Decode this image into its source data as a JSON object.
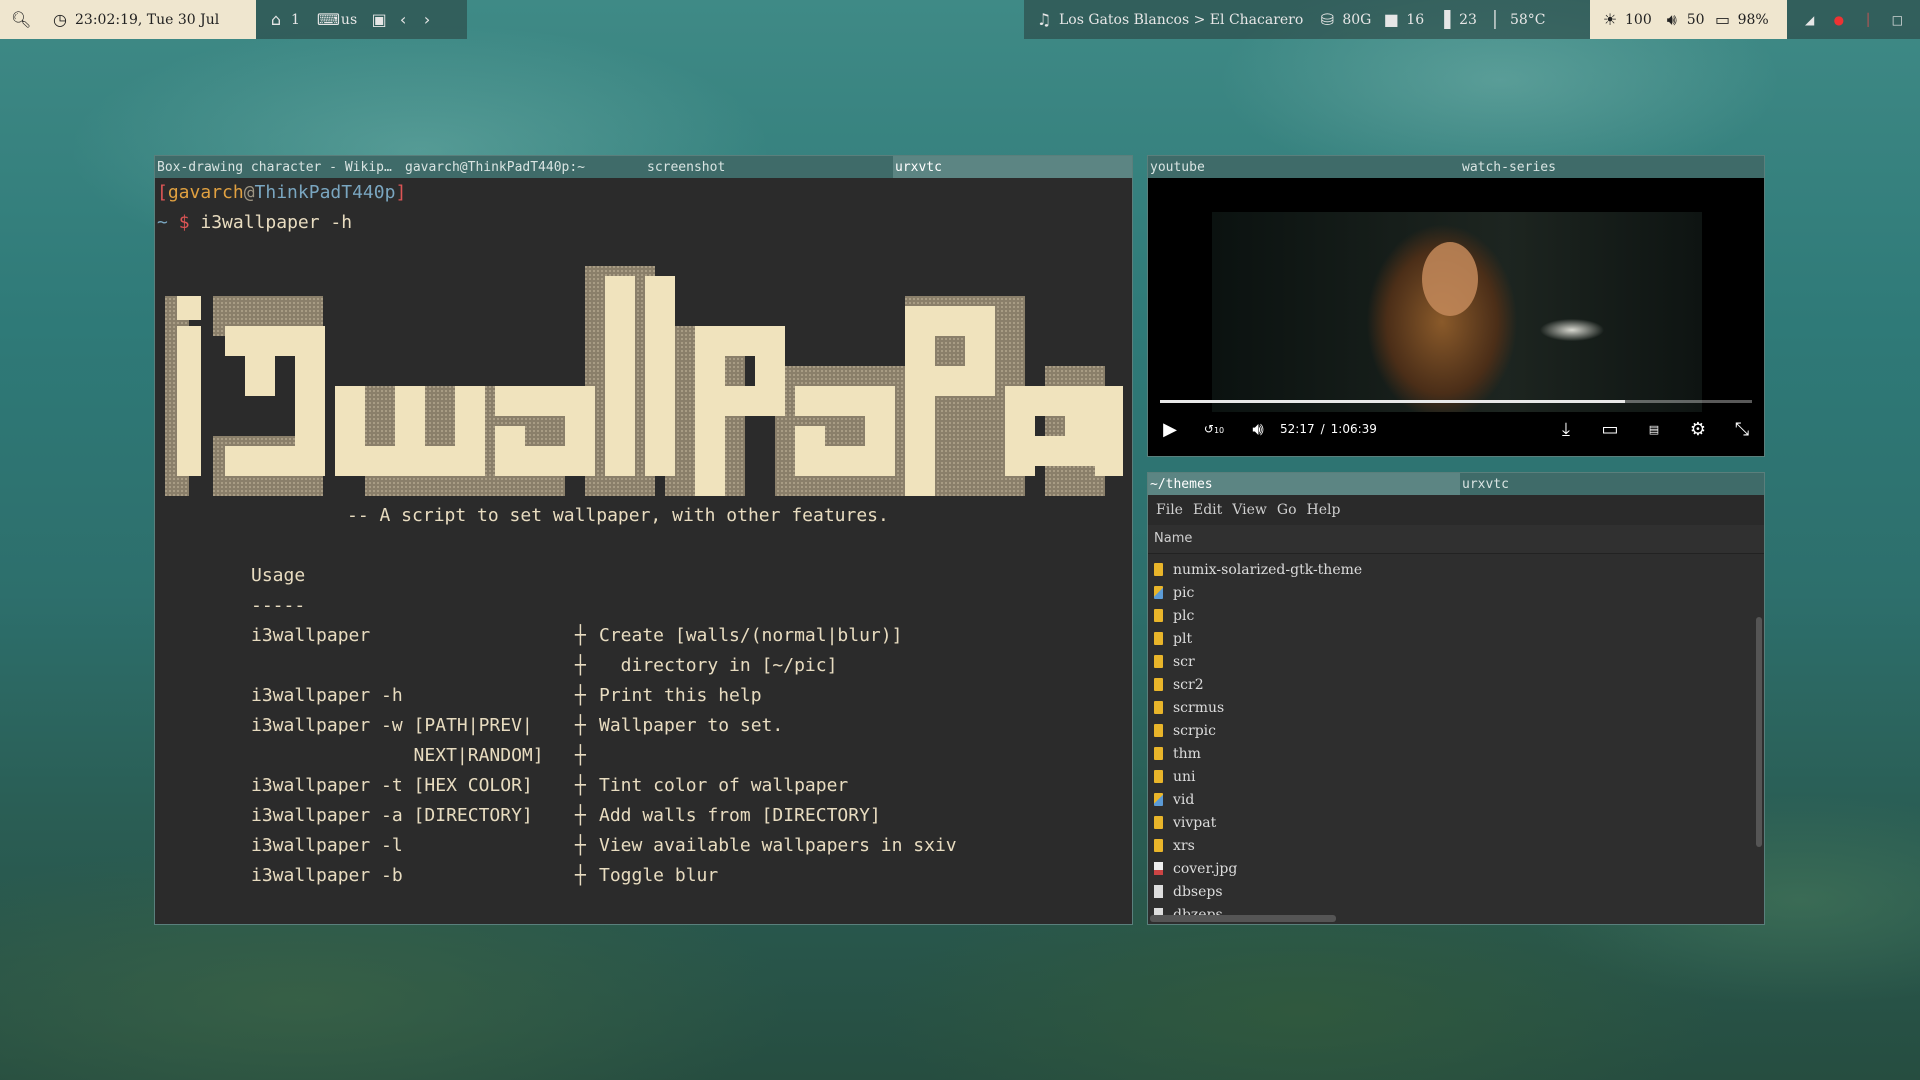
{
  "topbar": {
    "search_icon": "search-icon",
    "clock": "23:02:19, Tue 30 Jul",
    "workspace": "1",
    "keyboard_layout": "us",
    "music": "Los Gatos Blancos > El Chacarero",
    "disk": "80G",
    "save_count": "16",
    "memory": "23",
    "temperature": "58°C",
    "brightness": "100",
    "volume": "50",
    "battery": "98%"
  },
  "left_window": {
    "tabs": [
      "Box-drawing character - Wikip…",
      "gavarch@ThinkPadT440p:~",
      "screenshot",
      "urxvtc"
    ],
    "active_tab": 3,
    "prompt_open": "[",
    "prompt_user": "gavarch",
    "prompt_at": "@",
    "prompt_host": "ThinkPadT440p",
    "prompt_close": "]",
    "cwd": "~",
    "dollar": "$",
    "command": "i3wallpaper -h",
    "logo_text": "i3wallPaPer",
    "tagline": "-- A script to set wallpaper, with other features.",
    "usage_title": "Usage",
    "usage_rule": "-----",
    "usage": [
      {
        "cmd": "i3wallpaper",
        "desc": "Create [walls/(normal|blur)]"
      },
      {
        "cmd": "",
        "desc": "  directory in [~/pic]"
      },
      {
        "cmd": "i3wallpaper -h",
        "desc": "Print this help"
      },
      {
        "cmd": "i3wallpaper -w [PATH|PREV|",
        "desc": "Wallpaper to set."
      },
      {
        "cmd": "               NEXT|RANDOM]",
        "desc": ""
      },
      {
        "cmd": "i3wallpaper -t [HEX COLOR]",
        "desc": "Tint color of wallpaper"
      },
      {
        "cmd": "i3wallpaper -a [DIRECTORY]",
        "desc": "Add walls from [DIRECTORY]"
      },
      {
        "cmd": "i3wallpaper -l",
        "desc": "View available wallpapers in sxiv"
      },
      {
        "cmd": "i3wallpaper -b",
        "desc": "Toggle blur"
      }
    ]
  },
  "video_window": {
    "tabs": [
      "youtube",
      "watch-series"
    ],
    "current_time": "52:17",
    "separator": "/",
    "duration": "1:06:39",
    "progress_fraction": 0.785,
    "rewind_label": "10"
  },
  "fm_window": {
    "tabs": [
      "~/themes",
      "urxvtc"
    ],
    "menu": [
      "File",
      "Edit",
      "View",
      "Go",
      "Help"
    ],
    "column_name": "Name",
    "files": [
      {
        "name": "numix-solarized-gtk-theme",
        "kind": "folder"
      },
      {
        "name": "pic",
        "kind": "folder-pic"
      },
      {
        "name": "plc",
        "kind": "folder"
      },
      {
        "name": "plt",
        "kind": "folder"
      },
      {
        "name": "scr",
        "kind": "folder"
      },
      {
        "name": "scr2",
        "kind": "folder"
      },
      {
        "name": "scrmus",
        "kind": "folder"
      },
      {
        "name": "scrpic",
        "kind": "folder"
      },
      {
        "name": "thm",
        "kind": "folder"
      },
      {
        "name": "uni",
        "kind": "folder"
      },
      {
        "name": "vid",
        "kind": "folder-pic"
      },
      {
        "name": "vivpat",
        "kind": "folder"
      },
      {
        "name": "xrs",
        "kind": "folder"
      },
      {
        "name": "cover.jpg",
        "kind": "image"
      },
      {
        "name": "dbseps",
        "kind": "file"
      },
      {
        "name": "dbzeps",
        "kind": "file"
      }
    ]
  }
}
